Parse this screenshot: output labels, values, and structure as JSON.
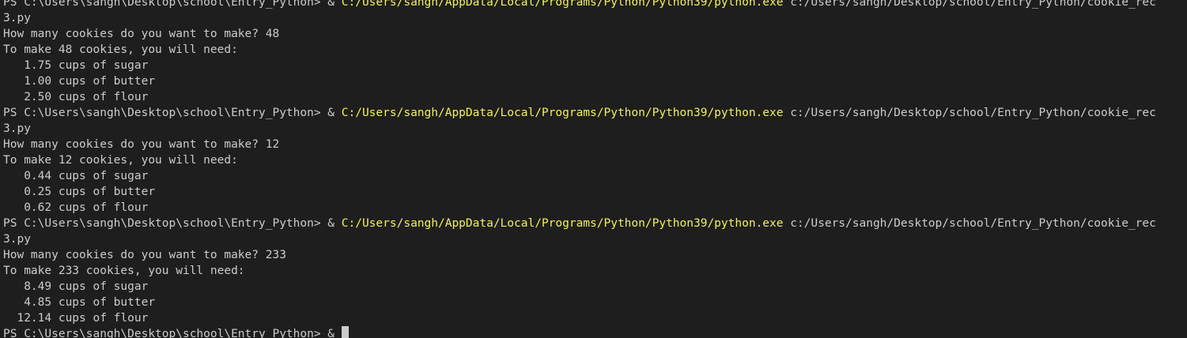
{
  "terminal": {
    "colors": {
      "background": "#1e1e1e",
      "text": "#cccccc",
      "command": "#f1f15c"
    },
    "lines": [
      {
        "type": "text",
        "text": "3.py"
      },
      {
        "type": "text",
        "text": "How many cookies do you want to make? 48"
      },
      {
        "type": "text",
        "text": "To make 48 cookies, you will need:"
      },
      {
        "type": "text",
        "text": "   1.75 cups of sugar"
      },
      {
        "type": "text",
        "text": "   1.00 cups of butter"
      },
      {
        "type": "text",
        "text": "   2.50 cups of flour"
      },
      {
        "type": "prompt",
        "prompt": "PS C:\\Users\\sangh\\Desktop\\school\\Entry_Python> & ",
        "command": "C:/Users/sangh/AppData/Local/Programs/Python/Python39/python.exe",
        "args": " c:/Users/sangh/Desktop/school/Entry_Python/cookie_rec"
      },
      {
        "type": "text",
        "text": "3.py"
      },
      {
        "type": "text",
        "text": "How many cookies do you want to make? 12"
      },
      {
        "type": "text",
        "text": "To make 12 cookies, you will need:"
      },
      {
        "type": "text",
        "text": "   0.44 cups of sugar"
      },
      {
        "type": "text",
        "text": "   0.25 cups of butter"
      },
      {
        "type": "text",
        "text": "   0.62 cups of flour"
      },
      {
        "type": "prompt",
        "prompt": "PS C:\\Users\\sangh\\Desktop\\school\\Entry_Python> & ",
        "command": "C:/Users/sangh/AppData/Local/Programs/Python/Python39/python.exe",
        "args": " c:/Users/sangh/Desktop/school/Entry_Python/cookie_rec"
      },
      {
        "type": "text",
        "text": "3.py"
      },
      {
        "type": "text",
        "text": "How many cookies do you want to make? 233"
      },
      {
        "type": "text",
        "text": "To make 233 cookies, you will need:"
      },
      {
        "type": "text",
        "text": "   8.49 cups of sugar"
      },
      {
        "type": "text",
        "text": "   4.85 cups of butter"
      },
      {
        "type": "text",
        "text": "  12.14 cups of flour"
      }
    ]
  }
}
